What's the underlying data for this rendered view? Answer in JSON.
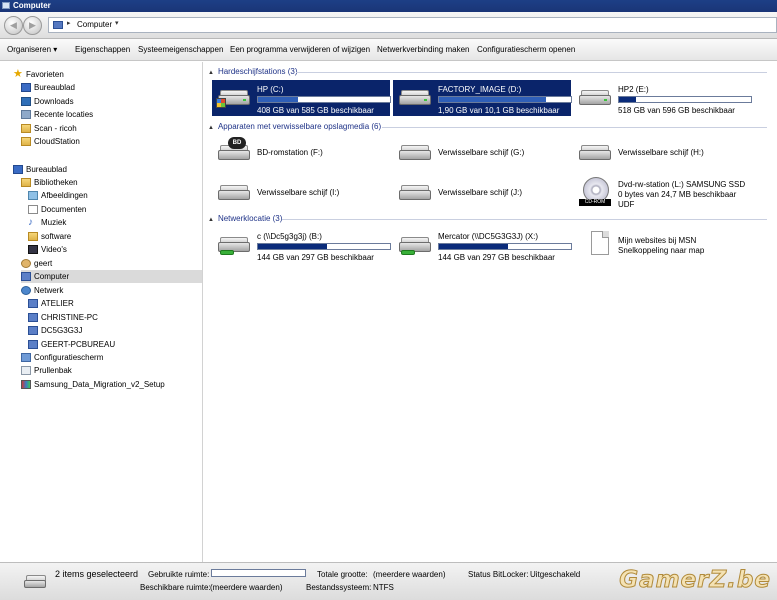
{
  "window": {
    "title": "Computer"
  },
  "address": {
    "crumb": "Computer",
    "back_icon": "back-arrow-icon",
    "forward_icon": "forward-arrow-icon"
  },
  "toolbar": {
    "organize": "Organiseren",
    "properties": "Eigenschappen",
    "system_properties": "Systeemeigenschappen",
    "uninstall": "Een programma verwijderen of wijzigen",
    "map_network": "Netwerkverbinding maken",
    "control_panel": "Configuratiescherm openen"
  },
  "sidebar": {
    "favorites": "Favorieten",
    "fav_items": [
      "Bureaublad",
      "Downloads",
      "Recente locaties",
      "Scan - ricoh",
      "CloudStation"
    ],
    "desktop": "Bureaublad",
    "libraries": "Bibliotheken",
    "lib_items": [
      "Afbeeldingen",
      "Documenten",
      "Muziek",
      "software",
      "Video's"
    ],
    "user": "geert",
    "computer": "Computer",
    "network": "Netwerk",
    "net_items": [
      "ATELIER",
      "CHRISTINE-PC",
      "DC5G3G3J",
      "GEERT-PCBUREAU"
    ],
    "control_panel": "Configuratiescherm",
    "recycle_bin": "Prullenbak",
    "setup": "Samsung_Data_Migration_v2_Setup"
  },
  "groups": {
    "hdd": "Hardeschijfstations (3)",
    "removable": "Apparaten met verwisselbare opslagmedia (6)",
    "network": "Netwerklocatie (3)"
  },
  "drives": {
    "c": {
      "name": "HP (C:)",
      "free": "408 GB van 585 GB beschikbaar",
      "used_fraction": 0.3
    },
    "d": {
      "name": "FACTORY_IMAGE (D:)",
      "free": "1,90 GB van 10,1 GB beschikbaar",
      "used_fraction": 0.81
    },
    "e": {
      "name": "HP2 (E:)",
      "free": "518 GB van 596 GB beschikbaar",
      "used_fraction": 0.13
    }
  },
  "removable": {
    "bd": {
      "name": "BD-romstation (F:)",
      "badge": "BD"
    },
    "g": {
      "name": "Verwisselbare schijf (G:)"
    },
    "h": {
      "name": "Verwisselbare schijf (H:)"
    },
    "i": {
      "name": "Verwisselbare schijf (I:)"
    },
    "j": {
      "name": "Verwisselbare schijf (J:)"
    },
    "l": {
      "name": "Dvd-rw-station (L:) SAMSUNG SSD",
      "line2": "0 bytes van 24,7 MB beschikbaar",
      "line3": "UDF",
      "badge": "CD-ROM"
    }
  },
  "network": {
    "b": {
      "name": "c (\\\\Dc5g3g3j) (B:)",
      "free": "144 GB van 297 GB beschikbaar",
      "used_fraction": 0.52
    },
    "x": {
      "name": "Mercator (\\\\DC5G3G3J) (X:)",
      "free": "144 GB van 297 GB beschikbaar",
      "used_fraction": 0.52
    },
    "msn": {
      "name": "Mijn websites bij MSN",
      "line2": "Snelkoppeling naar map"
    }
  },
  "status": {
    "selected": "2 items geselecteerd",
    "used_label": "Gebruikte ruimte:",
    "total_label": "Totale grootte:",
    "total_value": "(meerdere waarden)",
    "bitlocker_label": "Status BitLocker:",
    "bitlocker_value": "Uitgeschakeld",
    "free_label": "Beschikbare ruimte:",
    "free_value": "(meerdere waarden)",
    "fs_label": "Bestandssysteem:",
    "fs_value": "NTFS",
    "watermark": "GamerZ.be"
  }
}
